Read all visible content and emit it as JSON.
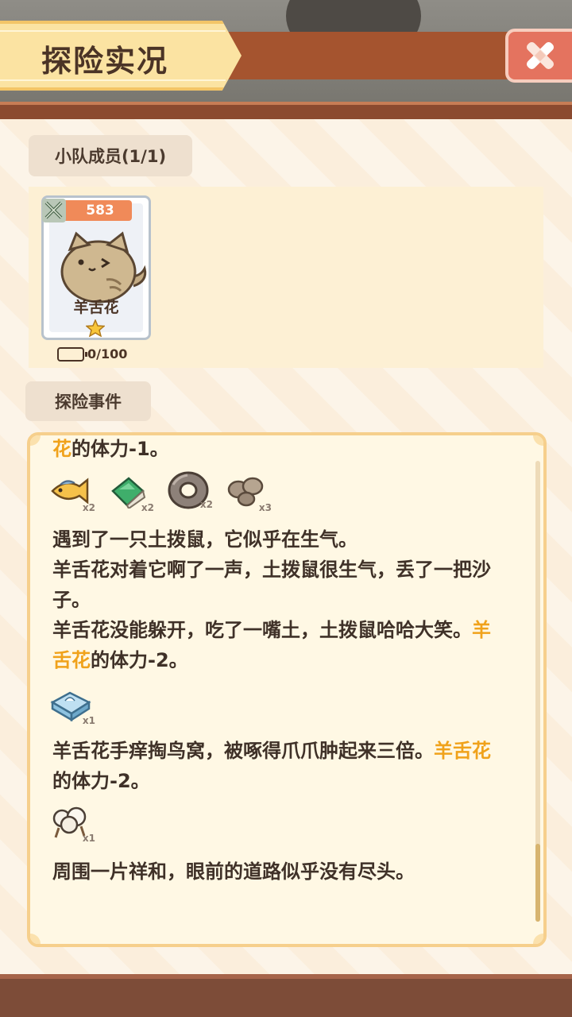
{
  "header": {
    "title": "探险实况"
  },
  "members": {
    "label": "小队成员(1/1)",
    "card": {
      "power": "583",
      "name": "羊舌花",
      "stars": 1,
      "stamina": "0/100"
    }
  },
  "events": {
    "label": "探险事件",
    "lines": [
      {
        "hl": "花",
        "text": "的体力-1。"
      },
      {
        "text": "遇到了一只土拨鼠，它似乎在生气。"
      },
      {
        "text": "羊舌花对着它啊了一声，土拨鼠很生气，丢了一把沙"
      },
      {
        "text": "子。"
      },
      {
        "text": "羊舌花没能躲开，吃了一嘴土，土拨鼠哈哈大笑。",
        "hl": "羊"
      },
      {
        "hl": "舌花",
        "text": "的体力-2。"
      },
      {
        "text": "羊舌花手痒掏鸟窝，被啄得爪爪肿起来三倍。",
        "hl": "羊舌花"
      },
      {
        "text": "的体力-2。"
      },
      {
        "text": "周围一片祥和，眼前的道路似乎没有尽头。"
      }
    ],
    "rewards_1": [
      {
        "icon": "fish-icon",
        "qty": "x2"
      },
      {
        "icon": "green-block-icon",
        "qty": "x2"
      },
      {
        "icon": "stone-ring-icon",
        "qty": "x2"
      },
      {
        "icon": "rock-pile-icon",
        "qty": "x3"
      }
    ],
    "rewards_2": [
      {
        "icon": "tissue-box-icon",
        "qty": "x1"
      }
    ],
    "rewards_3": [
      {
        "icon": "cotton-icon",
        "qty": "x1"
      }
    ]
  },
  "colors": {
    "highlight": "#f0a21b",
    "close_button": "#e4735f",
    "banner": "#fbe3a2"
  }
}
